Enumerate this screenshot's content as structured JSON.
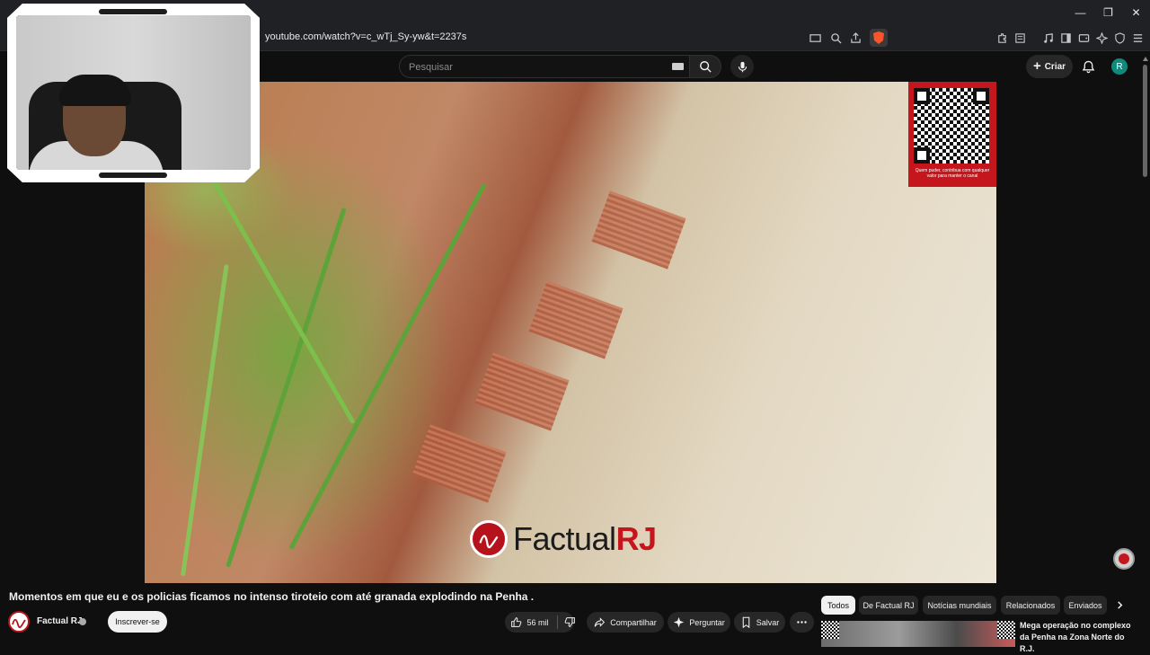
{
  "browser": {
    "url": "youtube.com/watch?v=c_wTj_Sy-yw&t=2237s",
    "window_controls": [
      "minimize-icon",
      "restore-icon",
      "close-icon"
    ]
  },
  "header": {
    "search_placeholder": "Pesquisar",
    "create_label": "Criar",
    "avatar_letter": "R"
  },
  "video": {
    "brand_name": "Factual",
    "brand_suffix": "RJ",
    "qr_caption": "Quem puder, contribua com qualquer valor para manter o canal"
  },
  "watch": {
    "title": "Momentos em que eu e os policias ficamos no intenso tiroteio com até granada explodindo na Penha .",
    "channel_name": "Factual RJ",
    "subscribe_label": "Inscrever-se",
    "likes": "56 mil",
    "share_label": "Compartilhar",
    "ask_label": "Perguntar",
    "save_label": "Salvar"
  },
  "chips": [
    "Todos",
    "De Factual RJ",
    "Notícias mundiais",
    "Relacionados",
    "Enviados"
  ],
  "related": [
    {
      "title": "Mega operação no complexo da Penha  na Zona Norte do R.J."
    }
  ],
  "colors": {
    "background": "#0f0f0f",
    "brand_red": "#c4161c",
    "avatar": "#0f8a7c"
  }
}
